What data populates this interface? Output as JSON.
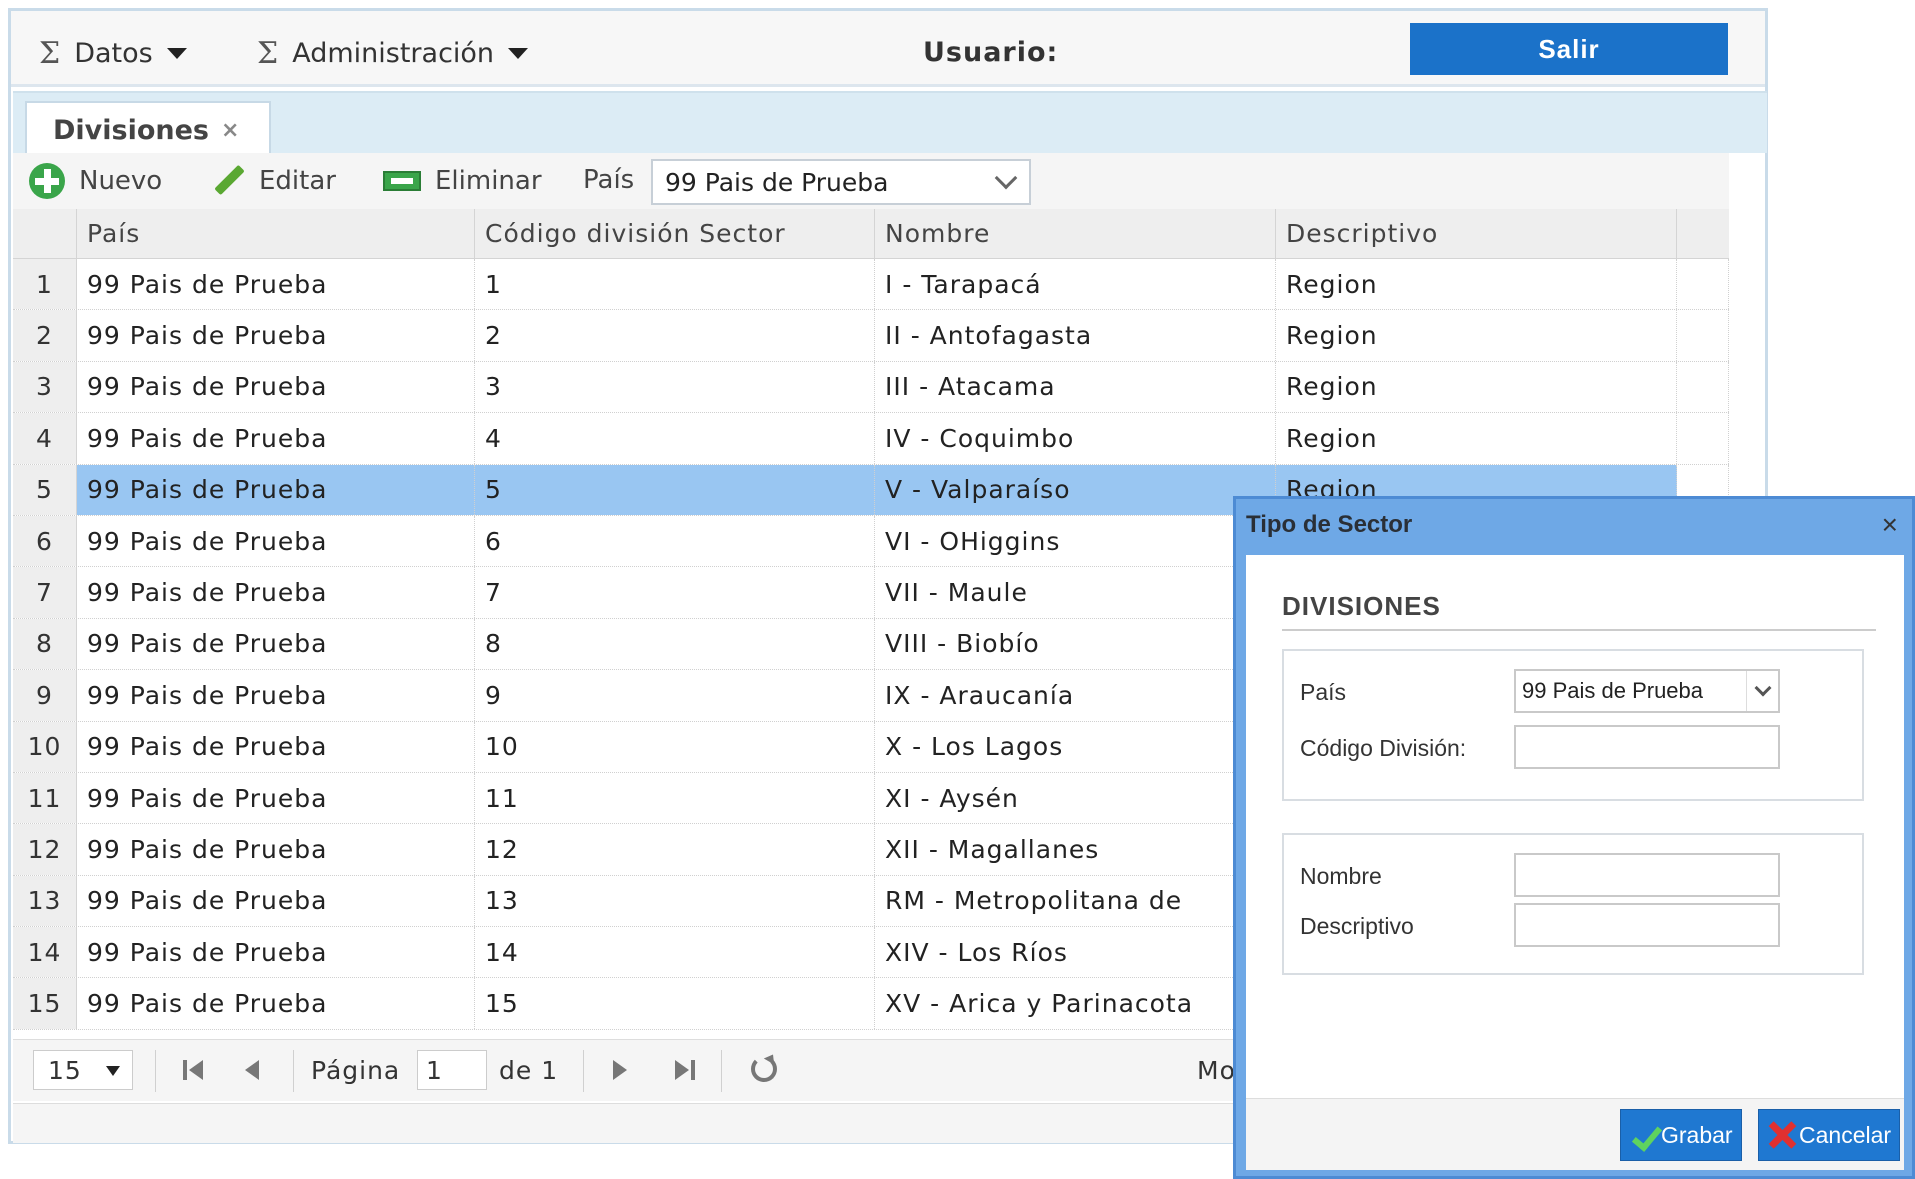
{
  "topbar": {
    "menu_datos": "Datos",
    "menu_admin": "Administración",
    "sigma": "Σ",
    "user_label": "Usuario:",
    "logout_label": "Salir"
  },
  "tabs": [
    {
      "label": "Divisiones",
      "close": "×"
    }
  ],
  "toolbar": {
    "new_label": "Nuevo",
    "edit_label": "Editar",
    "delete_label": "Eliminar",
    "country_label": "País",
    "country_value": "99 Pais de Prueba"
  },
  "grid": {
    "columns": [
      "País",
      "Código división Sector",
      "Nombre",
      "Descriptivo"
    ],
    "rows": [
      {
        "n": "1",
        "pais": "99 Pais de Prueba",
        "codigo": "1",
        "nombre": "I - Tarapacá",
        "desc": "Region"
      },
      {
        "n": "2",
        "pais": "99 Pais de Prueba",
        "codigo": "2",
        "nombre": "II - Antofagasta",
        "desc": "Region"
      },
      {
        "n": "3",
        "pais": "99 Pais de Prueba",
        "codigo": "3",
        "nombre": "III - Atacama",
        "desc": "Region"
      },
      {
        "n": "4",
        "pais": "99 Pais de Prueba",
        "codigo": "4",
        "nombre": "IV - Coquimbo",
        "desc": "Region"
      },
      {
        "n": "5",
        "pais": "99 Pais de Prueba",
        "codigo": "5",
        "nombre": "V - Valparaíso",
        "desc": "Region"
      },
      {
        "n": "6",
        "pais": "99 Pais de Prueba",
        "codigo": "6",
        "nombre": "VI - OHiggins",
        "desc": ""
      },
      {
        "n": "7",
        "pais": "99 Pais de Prueba",
        "codigo": "7",
        "nombre": "VII - Maule",
        "desc": ""
      },
      {
        "n": "8",
        "pais": "99 Pais de Prueba",
        "codigo": "8",
        "nombre": "VIII - Biobío",
        "desc": ""
      },
      {
        "n": "9",
        "pais": "99 Pais de Prueba",
        "codigo": "9",
        "nombre": "IX - Araucanía",
        "desc": ""
      },
      {
        "n": "10",
        "pais": "99 Pais de Prueba",
        "codigo": "10",
        "nombre": "X - Los Lagos",
        "desc": ""
      },
      {
        "n": "11",
        "pais": "99 Pais de Prueba",
        "codigo": "11",
        "nombre": "XI - Aysén",
        "desc": ""
      },
      {
        "n": "12",
        "pais": "99 Pais de Prueba",
        "codigo": "12",
        "nombre": "XII - Magallanes",
        "desc": ""
      },
      {
        "n": "13",
        "pais": "99 Pais de Prueba",
        "codigo": "13",
        "nombre": "RM - Metropolitana de",
        "desc": ""
      },
      {
        "n": "14",
        "pais": "99 Pais de Prueba",
        "codigo": "14",
        "nombre": "XIV - Los Ríos",
        "desc": ""
      },
      {
        "n": "15",
        "pais": "99 Pais de Prueba",
        "codigo": "15",
        "nombre": "XV - Arica y Parinacota",
        "desc": ""
      }
    ],
    "selected_row": 5
  },
  "pager": {
    "page_size": "15",
    "page_label": "Página",
    "page_value": "1",
    "of_label": "de 1",
    "more_text": "Mo"
  },
  "dialog": {
    "title": "Tipo de Sector",
    "close": "×",
    "heading": "DIVISIONES",
    "pais_label": "País",
    "pais_value": "99 Pais de Prueba",
    "codigo_label": "Código División:",
    "codigo_value": "",
    "nombre_label": "Nombre",
    "nombre_value": "",
    "descriptivo_label": "Descriptivo",
    "descriptivo_value": "",
    "save_label": "Grabar",
    "cancel_label": "Cancelar"
  },
  "colors": {
    "accent": "#1b72c9",
    "selected_row": "#99c6f2",
    "dialog_frame": "#6ea8e6",
    "tabstrip": "#dcecf5"
  }
}
